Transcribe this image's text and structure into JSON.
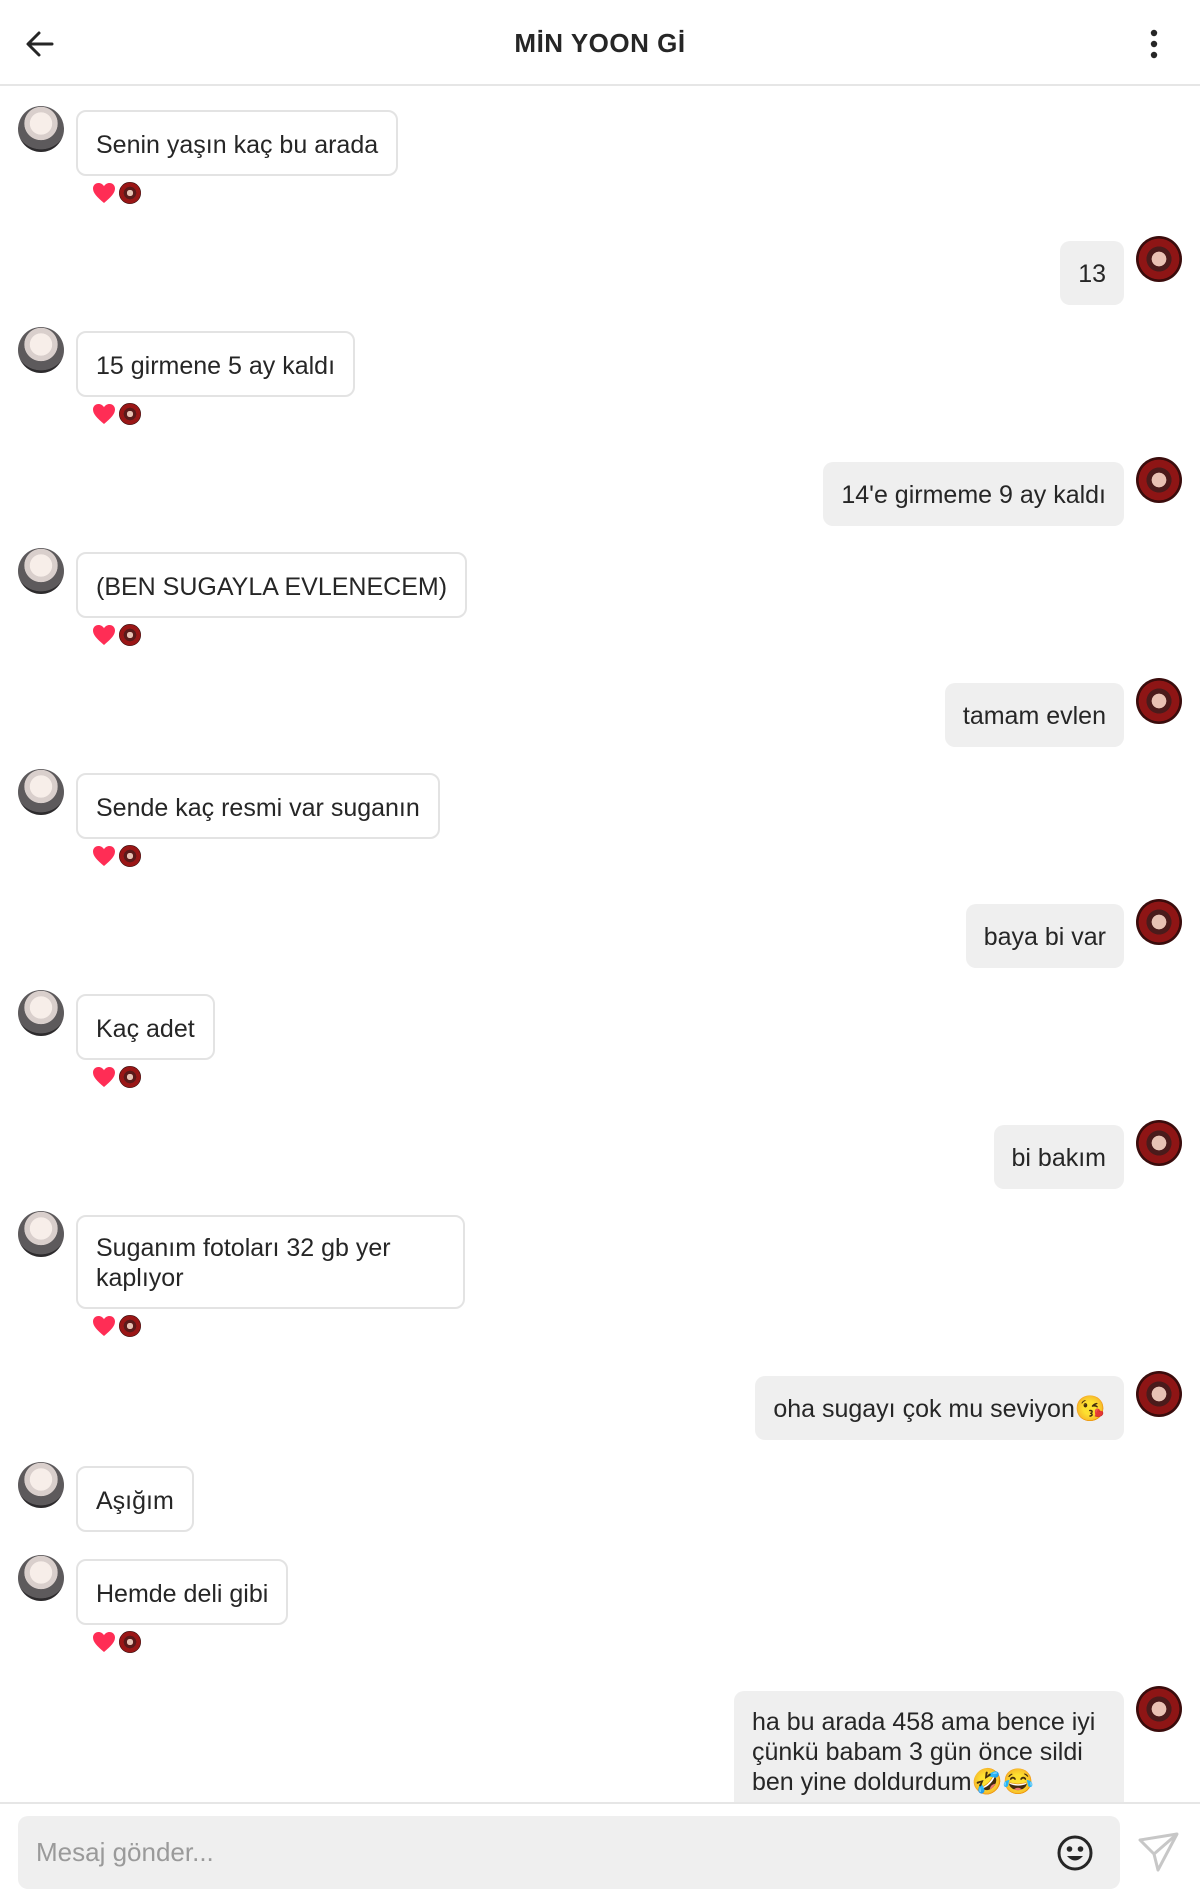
{
  "header": {
    "title": "MİN YOON Gİ",
    "back_icon": "arrow-left-icon",
    "menu_icon": "more-vertical-icon"
  },
  "messages": [
    {
      "from": "them",
      "text": "Senin yaşın kaç bu arada",
      "reaction": true
    },
    {
      "from": "me",
      "text": "13"
    },
    {
      "from": "them",
      "text": "15 girmene 5 ay kaldı",
      "reaction": true
    },
    {
      "from": "me",
      "text": "14'e girmeme 9 ay kaldı"
    },
    {
      "from": "them",
      "text": "(BEN SUGAYLA EVLENECEM)",
      "reaction": true
    },
    {
      "from": "me",
      "text": "tamam evlen"
    },
    {
      "from": "them",
      "text": "Sende kaç resmi var suganın",
      "reaction": true
    },
    {
      "from": "me",
      "text": "baya bi var"
    },
    {
      "from": "them",
      "text": "Kaç adet",
      "reaction": true
    },
    {
      "from": "me",
      "text": "bi bakım"
    },
    {
      "from": "them",
      "text": "Suganım fotoları 32 gb yer kaplıyor",
      "reaction": true
    },
    {
      "from": "me",
      "text": "oha sugayı çok mu seviyon😘"
    },
    {
      "from": "them",
      "text": "Aşığım",
      "reaction": false
    },
    {
      "from": "them",
      "text": "Hemde deli gibi",
      "reaction": true
    },
    {
      "from": "me",
      "text": "ha bu arada 458 ama bence iyi çünkü babam 3 gün önce sildi ben yine doldurdum🤣😂"
    }
  ],
  "composer": {
    "placeholder": "Mesaj gönder...",
    "emoji_icon": "smiley-icon",
    "send_icon": "send-icon"
  },
  "colors": {
    "reaction_heart": "#ff2d55",
    "my_bubble": "#efefef",
    "their_bubble_border": "#e3e3e3"
  }
}
